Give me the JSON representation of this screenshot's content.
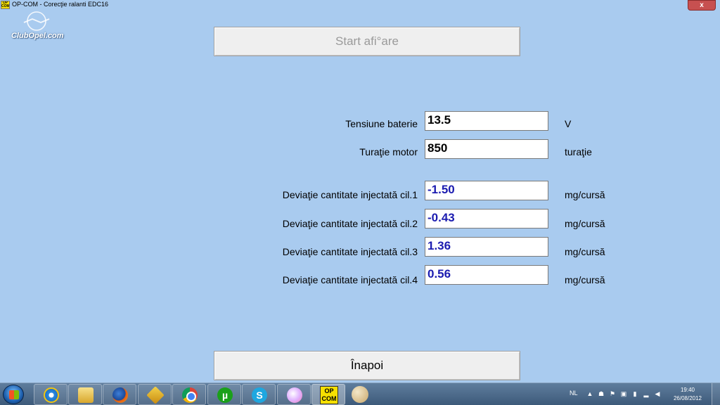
{
  "window": {
    "title": "OP-COM - Corecţie ralanti EDC16",
    "app_icon_lines": [
      "OP",
      "COM"
    ],
    "close_symbol": "x"
  },
  "logo": {
    "text": "ClubOpel.com"
  },
  "buttons": {
    "start": "Start afi°are",
    "back": "Înapoi"
  },
  "readings": [
    {
      "label": "Tensiune baterie",
      "value": "13.5",
      "unit": "V",
      "color": "#000000"
    },
    {
      "label": "Turaţie motor",
      "value": "850",
      "unit": "turaţie",
      "color": "#000000"
    },
    {
      "label": "Deviaţie cantitate injectată cil.1",
      "value": "-1.50",
      "unit": "mg/cursă",
      "color": "#1c1cb0"
    },
    {
      "label": "Deviaţie cantitate injectată cil.2",
      "value": "-0.43",
      "unit": "mg/cursă",
      "color": "#1c1cb0"
    },
    {
      "label": "Deviaţie cantitate injectată cil.3",
      "value": "1.36",
      "unit": "mg/cursă",
      "color": "#1c1cb0"
    },
    {
      "label": "Deviaţie cantitate injectată cil.4",
      "value": "0.56",
      "unit": "mg/cursă",
      "color": "#1c1cb0"
    }
  ],
  "taskbar": {
    "apps": [
      {
        "name": "internet-explorer-icon"
      },
      {
        "name": "windows-explorer-icon"
      },
      {
        "name": "firefox-icon"
      },
      {
        "name": "tool-icon"
      },
      {
        "name": "chrome-icon"
      },
      {
        "name": "utorrent-icon",
        "glyph": "µ"
      },
      {
        "name": "skype-icon",
        "glyph": "S"
      },
      {
        "name": "paint-icon"
      },
      {
        "name": "opcom-icon",
        "lines": [
          "OP",
          "COM"
        ]
      }
    ],
    "language": "NL",
    "time": "19:40",
    "date": "26/08/2012"
  }
}
